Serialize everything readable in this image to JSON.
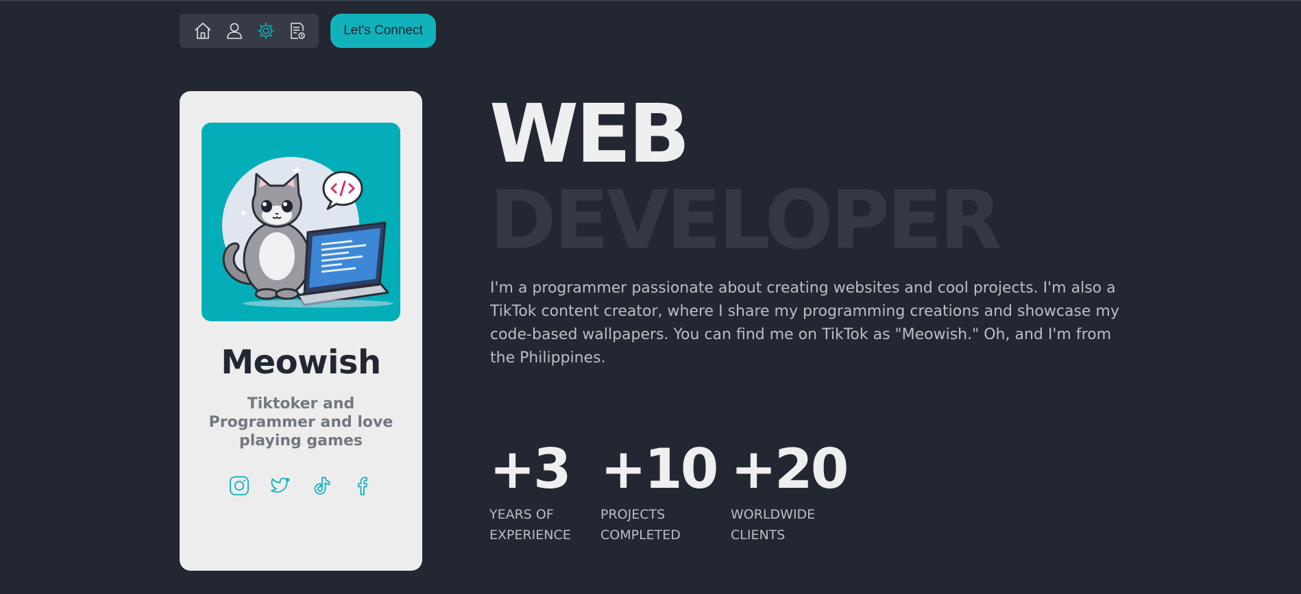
{
  "nav": {
    "items": [
      {
        "icon": "home-icon",
        "label": "Home"
      },
      {
        "icon": "user-icon",
        "label": "About"
      },
      {
        "icon": "gear-icon",
        "label": "Settings",
        "active": true
      },
      {
        "icon": "document-icon",
        "label": "Resume"
      }
    ],
    "connect_label": "Let's Connect"
  },
  "profile": {
    "name": "Meowish",
    "bio": "Tiktoker and Programmer and love playing games",
    "avatar_description": "cat-with-laptop-illustration",
    "socials": [
      "instagram-icon",
      "twitter-icon",
      "tiktok-icon",
      "facebook-icon"
    ]
  },
  "hero": {
    "title_line1": "WEB",
    "title_line2": "DEVELOPER",
    "intro": "I'm a programmer passionate about creating websites and cool projects. I'm also a TikTok content creator, where I share my programming creations and showcase my code-based wallpapers. You can find me on TikTok as \"Meowish.\" Oh, and I'm from the Philippines."
  },
  "stats": [
    {
      "value": "+3",
      "line1": "YEARS OF",
      "line2": "EXPERIENCE"
    },
    {
      "value": "+10",
      "line1": "PROJECTS",
      "line2": "COMPLETED"
    },
    {
      "value": "+20",
      "line1": "WORLDWIDE",
      "line2": "CLIENTS"
    }
  ],
  "colors": {
    "background": "#222731",
    "accent": "#11b2bb",
    "card": "#ededed",
    "title_faded": "#333843"
  }
}
